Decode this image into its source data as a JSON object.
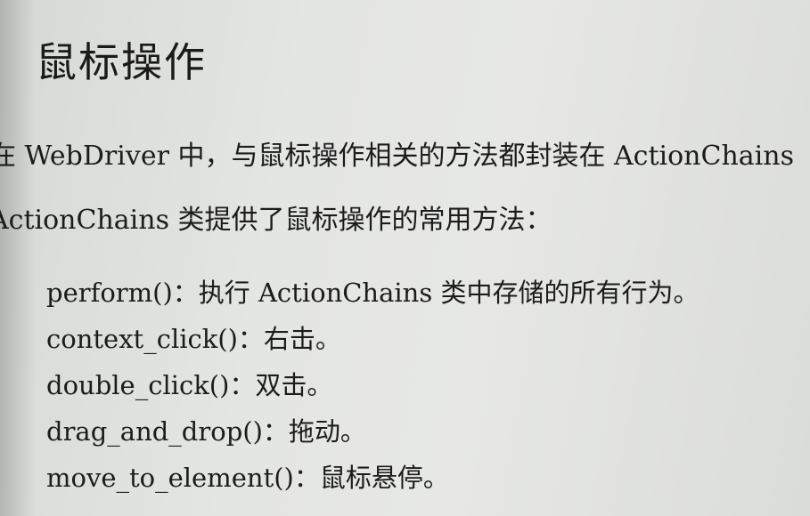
{
  "heading": "鼠标操作",
  "paragraphs": [
    "在 WebDriver 中，与鼠标操作相关的方法都封装在 ActionChains",
    "ActionChains 类提供了鼠标操作的常用方法："
  ],
  "methods": [
    "perform()：执行 ActionChains 类中存储的所有行为。",
    "context_click()：右击。",
    "double_click()：双击。",
    "drag_and_drop()：拖动。",
    "move_to_element()：鼠标悬停。"
  ]
}
